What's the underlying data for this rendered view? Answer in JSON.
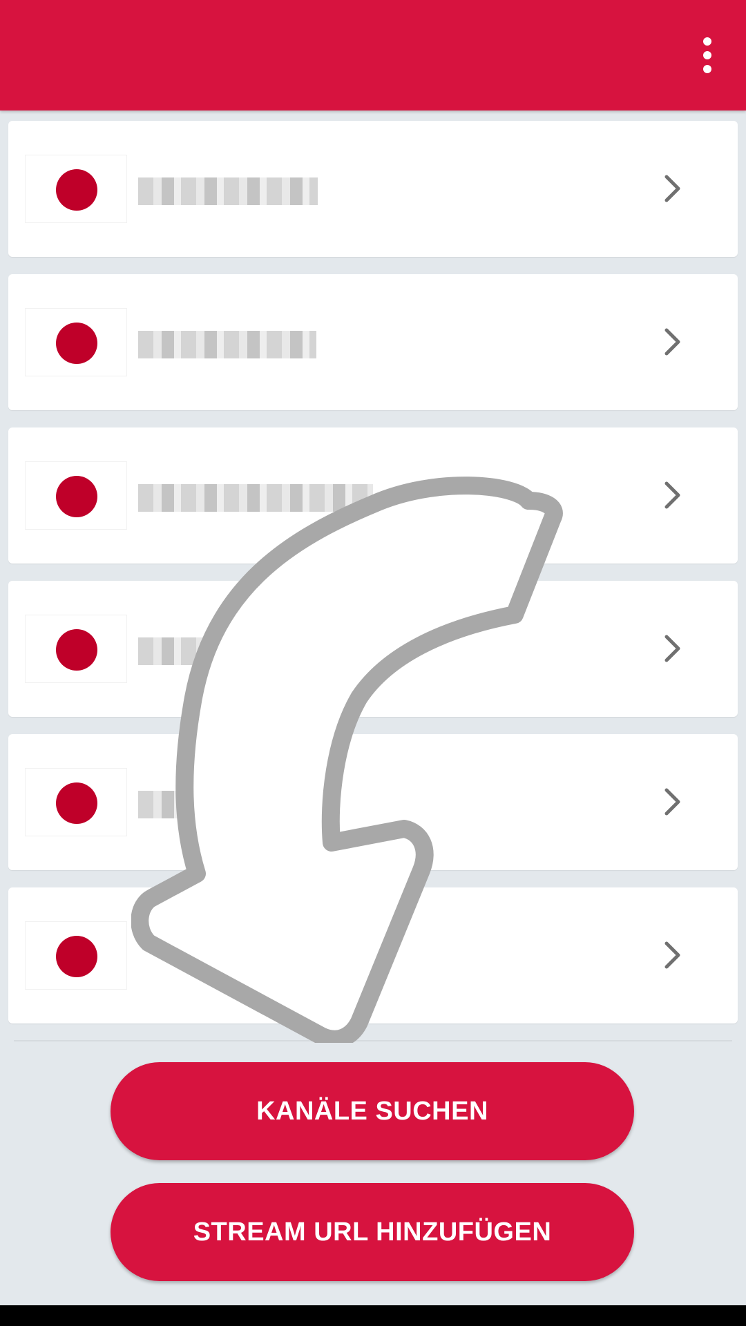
{
  "app_bar": {
    "color": "#d7133f",
    "menu_icon": "more-vert-icon"
  },
  "channels": [
    {
      "flag": "japan-flag-icon",
      "label": ""
    },
    {
      "flag": "japan-flag-icon",
      "label": ""
    },
    {
      "flag": "japan-flag-icon",
      "label": ""
    },
    {
      "flag": "japan-flag-icon",
      "label": ""
    },
    {
      "flag": "japan-flag-icon",
      "label": ""
    },
    {
      "flag": "japan-flag-icon",
      "label": ""
    }
  ],
  "buttons": {
    "search_label": "KANÄLE SUCHEN",
    "stream_label": "STREAM URL HINZUFÜGEN"
  },
  "overlay": {
    "icon": "curved-arrow-down-left-icon"
  },
  "colors": {
    "accent": "#d7133f",
    "flag_red": "#bf0029",
    "background": "#e3e8ec",
    "chevron": "#707070"
  }
}
